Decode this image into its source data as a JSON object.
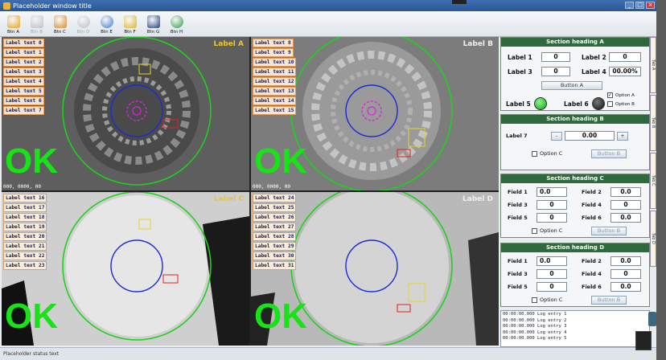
{
  "app": {
    "title": "Placeholder window title"
  },
  "toolbar": {
    "buttons": [
      {
        "id": "main",
        "label": "Btn A",
        "icon": "home-icon",
        "color": "#e6a31c",
        "enabled": true
      },
      {
        "id": "system",
        "label": "Btn B",
        "icon": "gear-icon",
        "color": "#8a8a8a",
        "enabled": false
      },
      {
        "id": "user",
        "label": "Btn C",
        "icon": "users-icon",
        "color": "#d88c2a",
        "enabled": true
      },
      {
        "id": "start",
        "label": "Btn D",
        "icon": "start-icon",
        "color": "#8a8a8a",
        "enabled": false
      },
      {
        "id": "stop",
        "label": "Btn E",
        "icon": "stop-icon",
        "color": "#3c78c8",
        "enabled": true
      },
      {
        "id": "change",
        "label": "Btn F",
        "icon": "change-model-icon",
        "color": "#e0b430",
        "enabled": true
      },
      {
        "id": "exit",
        "label": "Btn G",
        "icon": "exit-icon",
        "color": "#1f3f7a",
        "enabled": true
      },
      {
        "id": "reset",
        "label": "Btn H",
        "icon": "reset-icon",
        "color": "#2e9a3e",
        "enabled": true
      }
    ]
  },
  "views": [
    {
      "tag": "Label A",
      "tag_type": "neg",
      "coord": "000, 0000, 00",
      "lines": [
        "Label text 0",
        "Label text 1",
        "Label text 2",
        "Label text 3",
        "Label text 4",
        "Label text 5",
        "Label text 6",
        "Label text 7"
      ],
      "result": "OK"
    },
    {
      "tag": "Label B",
      "tag_type": "pos",
      "coord": "000, 0000, 00",
      "lines": [
        "Label text 8",
        "Label text 9",
        "Label text 10",
        "Label text 11",
        "Label text 12",
        "Label text 13",
        "Label text 14",
        "Label text 15"
      ],
      "result": "OK"
    },
    {
      "tag": "Label C",
      "tag_type": "neg",
      "coord": "",
      "lines": [
        "Label text 16",
        "Label text 17",
        "Label text 18",
        "Label text 19",
        "Label text 20",
        "Label text 21",
        "Label text 22",
        "Label text 23"
      ],
      "result": "OK"
    },
    {
      "tag": "Label D",
      "tag_type": "pos",
      "coord": "",
      "lines": [
        "Label text 24",
        "Label text 25",
        "Label text 26",
        "Label text 27",
        "Label text 28",
        "Label text 29",
        "Label text 30",
        "Label text 31"
      ],
      "result": "OK"
    }
  ],
  "stats": {
    "title": "Section heading A",
    "total_label": "Label 1",
    "total": "0",
    "ok_label": "Label 2",
    "ok": "0",
    "ng_label": "Label 3",
    "ng": "0",
    "rate_label": "Label 4",
    "rate": "00.00%",
    "reset_label": "Button A",
    "plc_label": "Label 5",
    "shot_label": "Label 6",
    "plc_ok_label": "Option A",
    "enable_label": "Option B"
  },
  "measure": {
    "title": "Section heading B",
    "ratio_label": "Label 7",
    "ratio_value": "0.00",
    "edit_label": "Option C",
    "save_label": "Button B"
  },
  "neg_params": {
    "title": "Section heading C",
    "outer_label": "Field 1",
    "outer": "0.0",
    "inner_label": "Field 2",
    "inner": "0.0",
    "bump_h_label": "Field 3",
    "bump_h": "0",
    "dent_d_label": "Field 4",
    "dent_d": "0",
    "bump_a_label": "Field 5",
    "bump_a": "0",
    "dent_a_label": "Field 6",
    "dent_a": "0.0",
    "edit_label": "Option C",
    "save_label": "Button B"
  },
  "pos_params": {
    "title": "Section heading D",
    "outer_label": "Field 1",
    "outer": "0.0",
    "inner_label": "Field 2",
    "inner": "0.0",
    "bump_h_label": "Field 3",
    "bump_h": "0",
    "dent_d_label": "Field 4",
    "dent_d": "0",
    "bump_a_label": "Field 5",
    "bump_a": "0",
    "dent_a_label": "Field 6",
    "dent_a": "0.0",
    "edit_label": "Option C",
    "save_label": "Button B"
  },
  "log": [
    "00:00:00.000 Log entry 1",
    "00:00:00.000 Log entry 2",
    "00:00:00.000 Log entry 3",
    "00:00:00.000 Log entry 4",
    "00:00:00.000 Log entry 5"
  ],
  "side_tabs": [
    "Tab A",
    "Tab B",
    "Tab C",
    "Tab D"
  ],
  "status": {
    "text": "Placeholder status text"
  },
  "colors": {
    "ok": "#19e219",
    "header": "#2f6a3f",
    "lamp_plc": "#22cc22",
    "lamp_shot": "#222222"
  }
}
